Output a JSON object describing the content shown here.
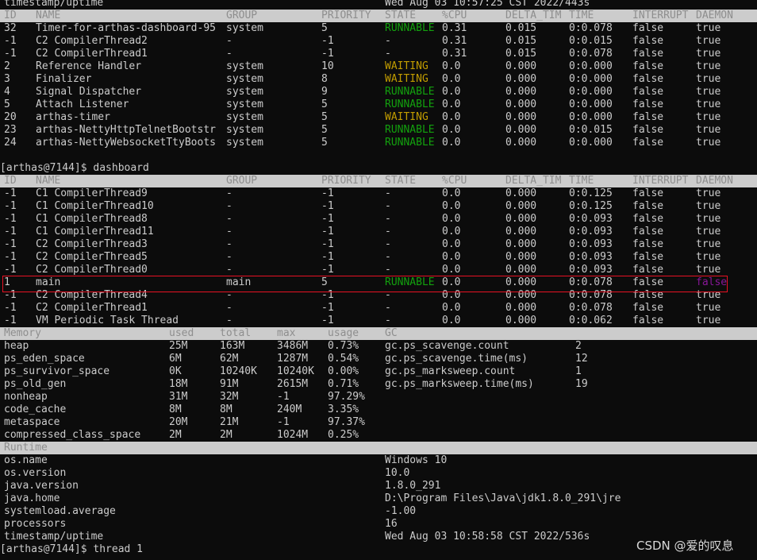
{
  "colors": {
    "background": "#0c0c0c",
    "text": "#cccccc",
    "header_bg": "#cccccc",
    "runnable": "#13a10e",
    "waiting": "#c19c00",
    "daemon_false": "#881798",
    "highlight": "#e81123"
  },
  "top": {
    "prev_line_left": "timestamp/uptime",
    "prev_line_right": "Wed Aug 03 10:57:25 CST 2022/443s",
    "header": [
      "ID",
      "NAME",
      "GROUP",
      "PRIORITY",
      "STATE",
      "%CPU",
      "DELTA_TIM",
      "TIME",
      "INTERRUPT",
      "DAEMON"
    ],
    "rows": [
      [
        "32",
        "Timer-for-arthas-dashboard-95",
        "system",
        "5",
        "RUNNABLE",
        "0.31",
        "0.015",
        "0:0.078",
        "false",
        "true"
      ],
      [
        "-1",
        "C2 CompilerThread2",
        "-",
        "-1",
        "-",
        "0.31",
        "0.015",
        "0:0.015",
        "false",
        "true"
      ],
      [
        "-1",
        "C2 CompilerThread1",
        "-",
        "-1",
        "-",
        "0.31",
        "0.015",
        "0:0.078",
        "false",
        "true"
      ],
      [
        "2",
        "Reference Handler",
        "system",
        "10",
        "WAITING",
        "0.0",
        "0.000",
        "0:0.000",
        "false",
        "true"
      ],
      [
        "3",
        "Finalizer",
        "system",
        "8",
        "WAITING",
        "0.0",
        "0.000",
        "0:0.000",
        "false",
        "true"
      ],
      [
        "4",
        "Signal Dispatcher",
        "system",
        "9",
        "RUNNABLE",
        "0.0",
        "0.000",
        "0:0.000",
        "false",
        "true"
      ],
      [
        "5",
        "Attach Listener",
        "system",
        "5",
        "RUNNABLE",
        "0.0",
        "0.000",
        "0:0.000",
        "false",
        "true"
      ],
      [
        "20",
        "arthas-timer",
        "system",
        "5",
        "WAITING",
        "0.0",
        "0.000",
        "0:0.000",
        "false",
        "true"
      ],
      [
        "23",
        "arthas-NettyHttpTelnetBootstr",
        "system",
        "5",
        "RUNNABLE",
        "0.0",
        "0.000",
        "0:0.015",
        "false",
        "true"
      ],
      [
        "24",
        "arthas-NettyWebsocketTtyBoots",
        "system",
        "5",
        "RUNNABLE",
        "0.0",
        "0.000",
        "0:0.000",
        "false",
        "true"
      ]
    ]
  },
  "prompt1": "[arthas@7144]$ dashboard",
  "threads": {
    "header": [
      "ID",
      "NAME",
      "GROUP",
      "PRIORITY",
      "STATE",
      "%CPU",
      "DELTA_TIM",
      "TIME",
      "INTERRUPT",
      "DAEMON"
    ],
    "rows": [
      [
        "-1",
        "C1 CompilerThread9",
        "-",
        "-1",
        "-",
        "0.0",
        "0.000",
        "0:0.125",
        "false",
        "true"
      ],
      [
        "-1",
        "C1 CompilerThread10",
        "-",
        "-1",
        "-",
        "0.0",
        "0.000",
        "0:0.125",
        "false",
        "true"
      ],
      [
        "-1",
        "C1 CompilerThread8",
        "-",
        "-1",
        "-",
        "0.0",
        "0.000",
        "0:0.093",
        "false",
        "true"
      ],
      [
        "-1",
        "C1 CompilerThread11",
        "-",
        "-1",
        "-",
        "0.0",
        "0.000",
        "0:0.093",
        "false",
        "true"
      ],
      [
        "-1",
        "C2 CompilerThread3",
        "-",
        "-1",
        "-",
        "0.0",
        "0.000",
        "0:0.093",
        "false",
        "true"
      ],
      [
        "-1",
        "C2 CompilerThread5",
        "-",
        "-1",
        "-",
        "0.0",
        "0.000",
        "0:0.093",
        "false",
        "true"
      ],
      [
        "-1",
        "C2 CompilerThread0",
        "-",
        "-1",
        "-",
        "0.0",
        "0.000",
        "0:0.093",
        "false",
        "true"
      ],
      [
        "1",
        "main",
        "main",
        "5",
        "RUNNABLE",
        "0.0",
        "0.000",
        "0:0.078",
        "false",
        "false"
      ],
      [
        "-1",
        "C2 CompilerThread4",
        "-",
        "-1",
        "-",
        "0.0",
        "0.000",
        "0:0.078",
        "false",
        "true"
      ],
      [
        "-1",
        "C2 CompilerThread1",
        "-",
        "-1",
        "-",
        "0.0",
        "0.000",
        "0:0.078",
        "false",
        "true"
      ],
      [
        "-1",
        "VM Periodic Task Thread",
        "-",
        "-1",
        "-",
        "0.0",
        "0.000",
        "0:0.062",
        "false",
        "true"
      ]
    ]
  },
  "memory": {
    "header": [
      "Memory",
      "used",
      "total",
      "max",
      "usage",
      "GC"
    ],
    "rows": [
      [
        "heap",
        "25M",
        "163M",
        "3486M",
        "0.73%"
      ],
      [
        "ps_eden_space",
        "6M",
        "62M",
        "1287M",
        "0.54%"
      ],
      [
        "ps_survivor_space",
        "0K",
        "10240K",
        "10240K",
        "0.00%"
      ],
      [
        "ps_old_gen",
        "18M",
        "91M",
        "2615M",
        "0.71%"
      ],
      [
        "nonheap",
        "31M",
        "32M",
        "-1",
        "97.29%"
      ],
      [
        "code_cache",
        "8M",
        "8M",
        "240M",
        "3.35%"
      ],
      [
        "metaspace",
        "20M",
        "21M",
        "-1",
        "97.37%"
      ],
      [
        "compressed_class_space",
        "2M",
        "2M",
        "1024M",
        "0.25%"
      ]
    ],
    "gc": [
      [
        "gc.ps_scavenge.count",
        "2"
      ],
      [
        "gc.ps_scavenge.time(ms)",
        "12"
      ],
      [
        "gc.ps_marksweep.count",
        "1"
      ],
      [
        "gc.ps_marksweep.time(ms)",
        "19"
      ]
    ]
  },
  "runtime": {
    "header": "Runtime",
    "rows": [
      [
        "os.name",
        "Windows 10"
      ],
      [
        "os.version",
        "10.0"
      ],
      [
        "java.version",
        "1.8.0_291"
      ],
      [
        "java.home",
        "D:\\Program Files\\Java\\jdk1.8.0_291\\jre"
      ],
      [
        "systemload.average",
        "-1.00"
      ],
      [
        "processors",
        "16"
      ],
      [
        "timestamp/uptime",
        "Wed Aug 03 10:58:58 CST 2022/536s"
      ]
    ]
  },
  "prompt2": "[arthas@7144]$ thread 1",
  "watermark": "CSDN @爱的叹息"
}
